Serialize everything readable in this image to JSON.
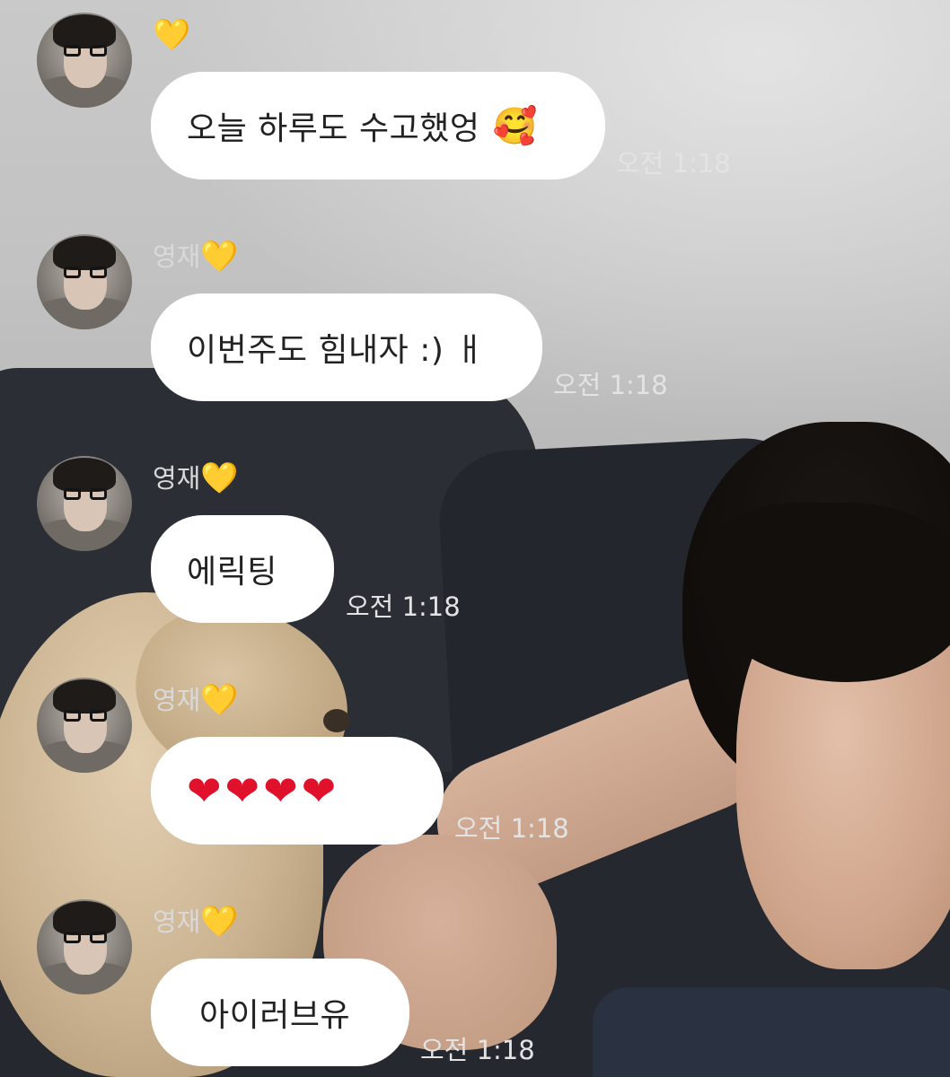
{
  "chat": {
    "messages": [
      {
        "sender": "",
        "sender_badge": "💛",
        "text": "오늘 하루도 수고했엉",
        "emoji": "🥰",
        "time": "오전 1:18"
      },
      {
        "sender": "영재",
        "sender_badge": "💛",
        "text": "이번주도 힘내자 :) ㅐ",
        "time": "오전 1:18"
      },
      {
        "sender": "영재",
        "sender_badge": "💛",
        "text": "에릭팅",
        "time": "오전 1:18"
      },
      {
        "sender": "영재",
        "sender_badge": "💛",
        "text": "❤❤❤❤",
        "time": "오전 1:18"
      },
      {
        "sender": "영재",
        "sender_badge": "💛",
        "text": "아이러브유",
        "time": "오전 1:18"
      }
    ]
  },
  "colors": {
    "bubble": "#ffffff",
    "bubble_text": "#222222",
    "meta_text": "#e3e3e3",
    "heart": "#e0112b",
    "badge_heart": "#f3c234"
  }
}
